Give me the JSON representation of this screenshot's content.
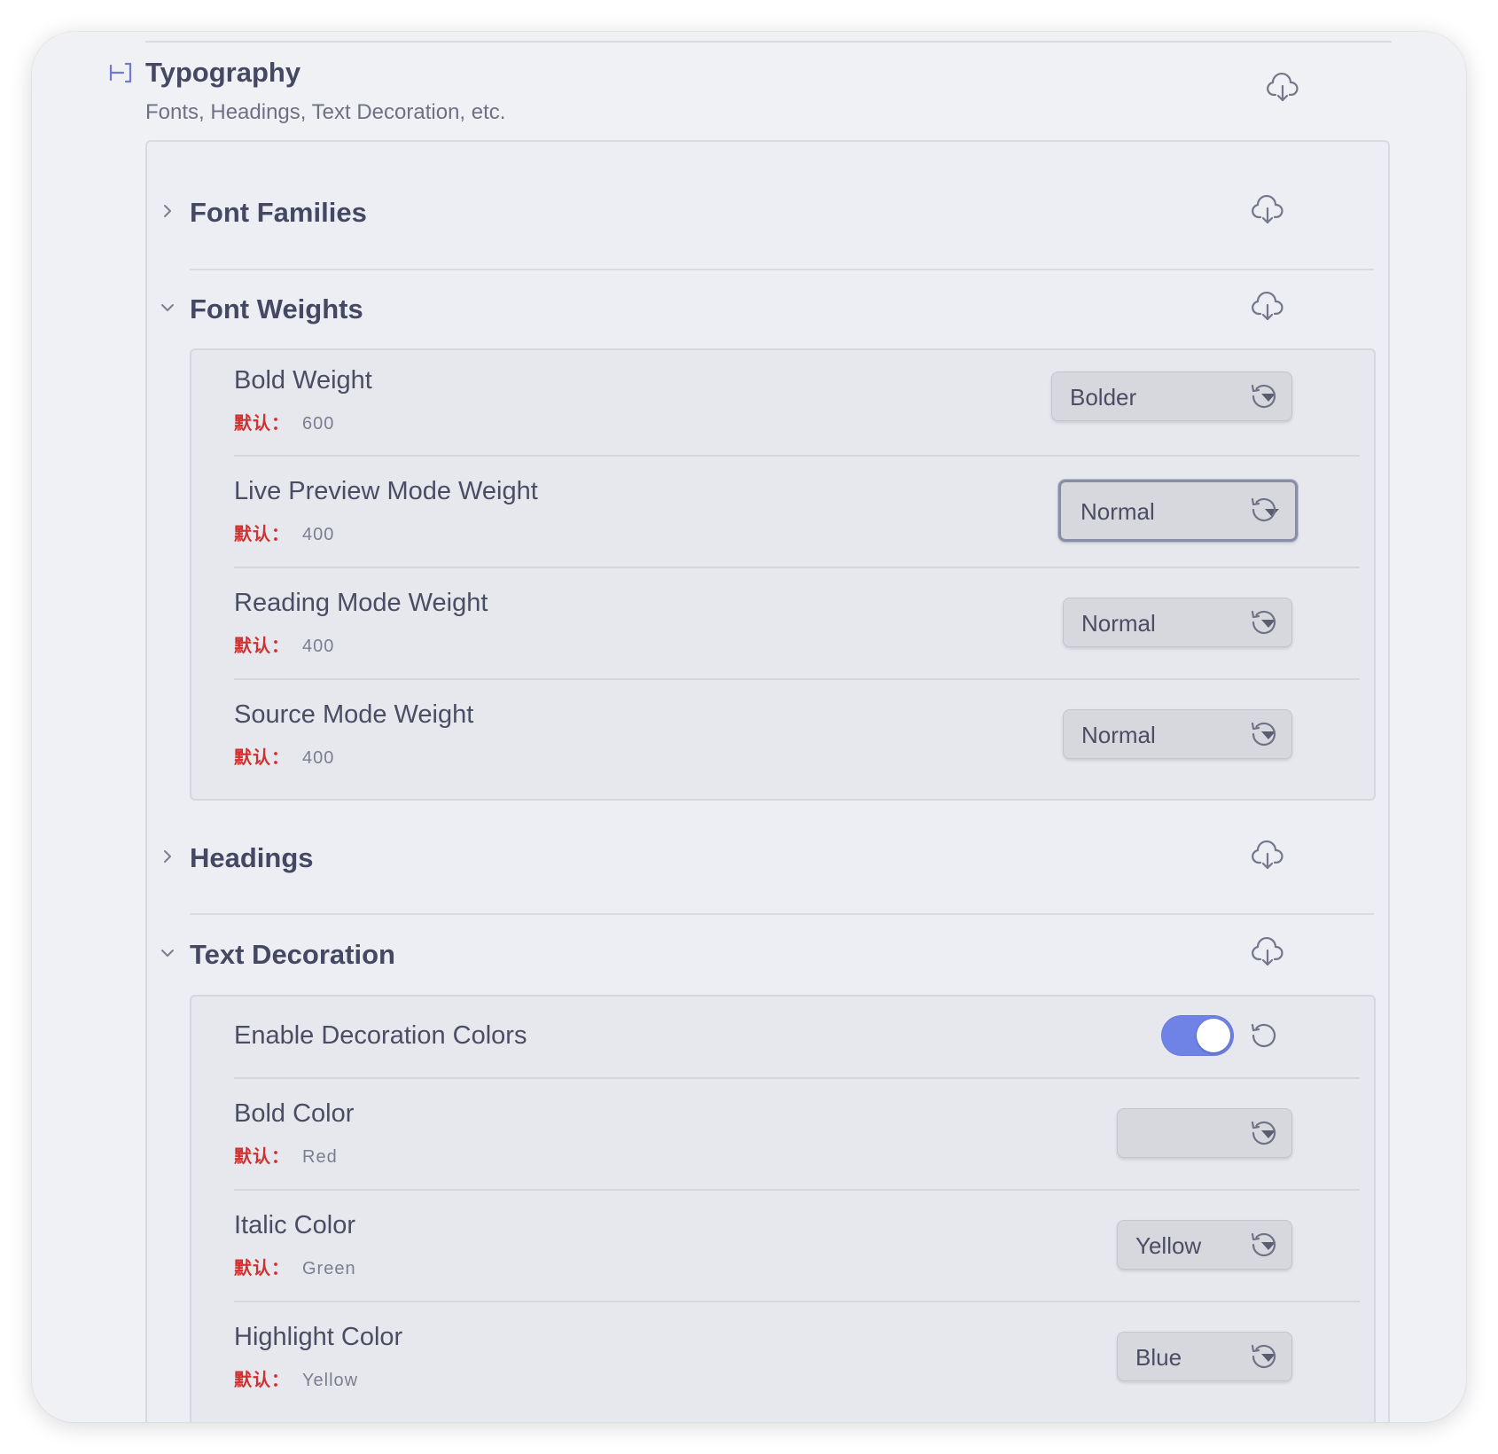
{
  "header": {
    "title": "Typography",
    "subtitle": "Fonts, Headings, Text Decoration, etc."
  },
  "default_key": "默认：",
  "sections": {
    "font_families": {
      "title": "Font Families",
      "expanded": false
    },
    "font_weights": {
      "title": "Font Weights",
      "expanded": true,
      "rows": [
        {
          "label": "Bold Weight",
          "default": "600",
          "value": "Bolder"
        },
        {
          "label": "Live Preview Mode Weight",
          "default": "400",
          "value": "Normal"
        },
        {
          "label": "Reading Mode Weight",
          "default": "400",
          "value": "Normal"
        },
        {
          "label": "Source Mode Weight",
          "default": "400",
          "value": "Normal"
        }
      ]
    },
    "headings": {
      "title": "Headings",
      "expanded": false
    },
    "text_decoration": {
      "title": "Text Decoration",
      "expanded": true,
      "toggle_row": {
        "label": "Enable Decoration Colors",
        "enabled": true
      },
      "rows": [
        {
          "label": "Bold Color",
          "default": "Red",
          "value": ""
        },
        {
          "label": "Italic Color",
          "default": "Green",
          "value": "Yellow"
        },
        {
          "label": "Highlight Color",
          "default": "Yellow",
          "value": "Blue"
        }
      ]
    }
  },
  "icons": {
    "header": "bracket-icon",
    "section_action": "cloud-download-icon",
    "row_action": "reset-icon",
    "collapsed": "chevron-right-icon",
    "expanded": "chevron-down-icon"
  },
  "colors": {
    "accent": "#6f82e6",
    "default_key": "#d32f2f",
    "background": "#f0f1f5"
  }
}
